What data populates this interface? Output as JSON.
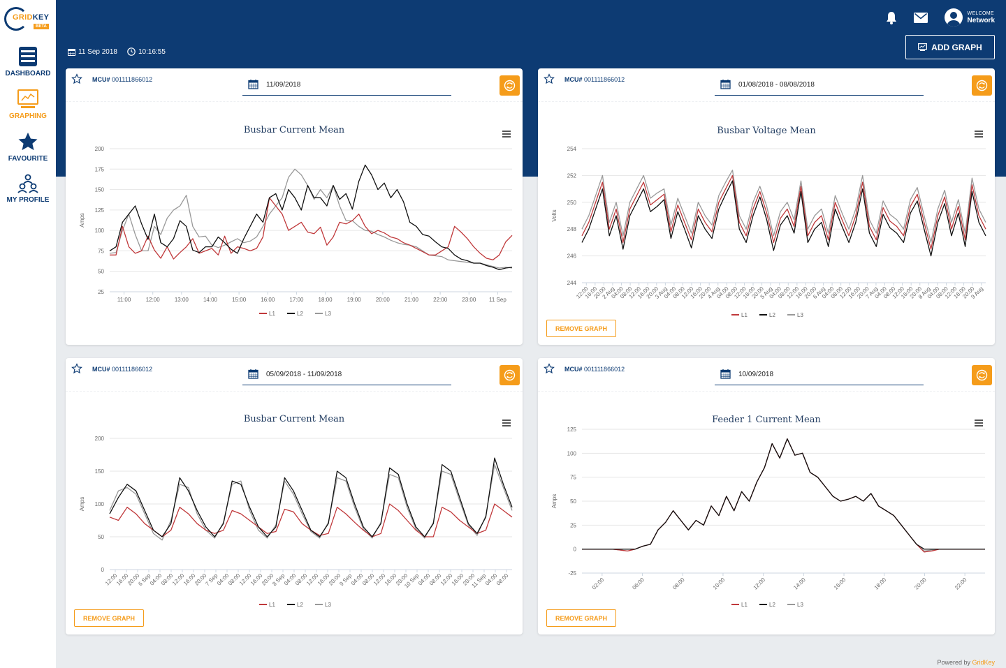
{
  "app": {
    "logo_text_a": "GRID",
    "logo_text_b": "KEY",
    "logo_badge": "BETA",
    "footer_prefix": "Powered by ",
    "footer_brand": "GridKey"
  },
  "sidebar": {
    "items": [
      {
        "label": "DASHBOARD",
        "icon": "dashboard-icon"
      },
      {
        "label": "GRAPHING",
        "icon": "graphing-icon",
        "active": true
      },
      {
        "label": "FAVOURITE",
        "icon": "star-icon"
      },
      {
        "label": "MY PROFILE",
        "icon": "profile-icon"
      }
    ]
  },
  "header": {
    "welcome": "WELCOME",
    "user": "Network",
    "date": "11 Sep 2018",
    "time": "10:16:55",
    "add_graph": "ADD GRAPH"
  },
  "colors": {
    "navy": "#0d3b73",
    "orange": "#f59c1a",
    "L1": "#c0393b",
    "L2": "#111111",
    "L3": "#999999"
  },
  "cards": [
    {
      "mcu_label": "MCU#",
      "mcu_id": "001111866012",
      "date": "11/09/2018",
      "title": "Busbar Current Mean",
      "remove": null,
      "chart_data": {
        "type": "line",
        "title": "Busbar Current Mean",
        "ylabel": "Amps",
        "ylim": [
          25,
          200
        ],
        "yticks": [
          "200",
          "175",
          "150",
          "125",
          "100",
          "75",
          "50",
          "25"
        ],
        "xticks": [
          "11:00",
          "12:00",
          "13:00",
          "14:00",
          "15:00",
          "16:00",
          "17:00",
          "18:00",
          "19:00",
          "20:00",
          "21:00",
          "22:00",
          "23:00",
          "11 Sep"
        ],
        "legend_position": "bottom",
        "series": [
          {
            "name": "L1",
            "values": [
              70,
              70,
              105,
              80,
              72,
              75,
              93,
              76,
              66,
              80,
              65,
              73,
              80,
              90,
              72,
              75,
              78,
              70,
              93,
              72,
              80,
              78,
              75,
              78,
              92,
              140,
              130,
              120,
              100,
              105,
              110,
              98,
              96,
              104,
              82,
              92,
              110,
              108,
              112,
              120,
              105,
              96,
              100,
              97,
              92,
              90,
              85,
              82,
              78,
              74,
              70,
              70,
              75,
              80,
              105,
              98,
              90,
              80,
              72,
              66,
              64,
              70,
              86,
              94
            ]
          },
          {
            "name": "L2",
            "values": [
              75,
              80,
              110,
              120,
              130,
              108,
              89,
              120,
              85,
              80,
              90,
              112,
              105,
              76,
              73,
              80,
              80,
              92,
              85,
              77,
              72,
              90,
              105,
              120,
              110,
              140,
              145,
              125,
              150,
              140,
              125,
              155,
              140,
              140,
              130,
              155,
              138,
              145,
              126,
              160,
              180,
              168,
              150,
              158,
              140,
              150,
              135,
              110,
              105,
              95,
              93,
              86,
              80,
              78,
              70,
              65,
              63,
              60,
              60,
              57,
              55,
              52,
              54,
              55
            ]
          },
          {
            "name": "L3",
            "values": [
              72,
              73,
              100,
              120,
              95,
              75,
              75,
              105,
              95,
              115,
              125,
              130,
              143,
              105,
              92,
              93,
              82,
              79,
              82,
              86,
              90,
              85,
              87,
              92,
              105,
              120,
              130,
              140,
              165,
              175,
              168,
              155,
              138,
              150,
              140,
              155,
              130,
              112,
              112,
              105,
              100,
              99,
              95,
              92,
              88,
              85,
              83,
              82,
              80,
              75,
              70,
              69,
              68,
              64,
              63,
              62,
              61,
              60,
              60,
              58,
              56,
              54,
              55,
              54
            ]
          }
        ]
      }
    },
    {
      "mcu_label": "MCU#",
      "mcu_id": "001111866012",
      "date": "01/08/2018 - 08/08/2018",
      "title": "Busbar Voltage Mean",
      "remove": "REMOVE GRAPH",
      "chart_data": {
        "type": "line",
        "title": "Busbar Voltage Mean",
        "ylabel": "Volts",
        "ylim": [
          244,
          254
        ],
        "yticks": [
          "254",
          "252",
          "250",
          "248",
          "246",
          "244"
        ],
        "xticks": [
          "12:00",
          "16:00",
          "20:00",
          "2 Aug",
          "04:00",
          "08:00",
          "12:00",
          "16:00",
          "20:00",
          "3 Aug",
          "04:00",
          "08:00",
          "12:00",
          "16:00",
          "20:00",
          "4 Aug",
          "04:00",
          "08:00",
          "12:00",
          "16:00",
          "20:00",
          "5 Aug",
          "04:00",
          "08:00",
          "12:00",
          "16:00",
          "20:00",
          "6 Aug",
          "04:00",
          "08:00",
          "12:00",
          "16:00",
          "20:00",
          "7 Aug",
          "04:00",
          "08:00",
          "12:00",
          "16:00",
          "20:00",
          "8 Aug",
          "04:00",
          "08:00",
          "12:00",
          "16:00",
          "20:00",
          "9 Aug"
        ],
        "legend_position": "bottom",
        "series": [
          {
            "name": "L1",
            "values": [
              247.5,
              248.5,
              250,
              251.5,
              248,
              249.5,
              247,
              249.5,
              250.5,
              251.5,
              249.8,
              250.2,
              250.6,
              247.8,
              249.8,
              248.5,
              247.2,
              249.5,
              248.5,
              247.8,
              250,
              251,
              252,
              248.5,
              247.5,
              249.5,
              250.8,
              249.2,
              247,
              248.8,
              249.5,
              248.2,
              251.2,
              247.5,
              248.5,
              249,
              247.2,
              250,
              248.7,
              247.5,
              249,
              251.5,
              248.2,
              247.2,
              249.6,
              248.6,
              248.2,
              247.5,
              249.7,
              250.6,
              248.5,
              246.5,
              249,
              250.4,
              248,
              249.7,
              247.2,
              251.3,
              249,
              248
            ]
          },
          {
            "name": "L2",
            "values": [
              247,
              248,
              249.5,
              251,
              247.5,
              249,
              246.5,
              249,
              250,
              251,
              249.3,
              249.7,
              250.2,
              247.3,
              249.3,
              248,
              246.6,
              249,
              248,
              247.3,
              249.5,
              250.6,
              251.6,
              248,
              247,
              249,
              250.4,
              248.7,
              246.4,
              248.3,
              249,
              247.7,
              250.8,
              247,
              248,
              248.5,
              246.7,
              249.5,
              248.2,
              247,
              248.5,
              251,
              247.7,
              246.7,
              249.1,
              248.1,
              247.7,
              247,
              249.2,
              250.1,
              248,
              246,
              248.5,
              249.9,
              247.5,
              249.2,
              246.7,
              250.8,
              248.5,
              247.5
            ]
          },
          {
            "name": "L3",
            "values": [
              248,
              249,
              250.5,
              252,
              248.5,
              250,
              247.5,
              250,
              251,
              252,
              250.3,
              250.7,
              251,
              248.3,
              250.3,
              249,
              247.7,
              250,
              249,
              248.3,
              250.5,
              251.5,
              252.4,
              249,
              248,
              250,
              251.2,
              249.7,
              247.5,
              249.3,
              250,
              248.7,
              251.6,
              248,
              249,
              249.5,
              247.7,
              250.5,
              249.2,
              248,
              249.5,
              252,
              248.7,
              247.7,
              250.1,
              249.1,
              248.7,
              248,
              250.2,
              251.1,
              249,
              247,
              249.5,
              250.9,
              248.5,
              250.2,
              247.7,
              251.8,
              249.5,
              248.5
            ]
          }
        ]
      }
    },
    {
      "mcu_label": "MCU#",
      "mcu_id": "001111866012",
      "date": "05/09/2018 - 11/09/2018",
      "title": "Busbar Current Mean",
      "remove": "REMOVE GRAPH",
      "chart_data": {
        "type": "line",
        "title": "Busbar Current Mean",
        "ylabel": "Amps",
        "ylim": [
          0,
          200
        ],
        "yticks": [
          "200",
          "150",
          "100",
          "50",
          "0"
        ],
        "xticks": [
          "12:00",
          "16:00",
          "20:00",
          "6 Sep",
          "04:00",
          "08:00",
          "12:00",
          "16:00",
          "20:00",
          "7 Sep",
          "04:00",
          "08:00",
          "12:00",
          "16:00",
          "20:00",
          "8 Sep",
          "04:00",
          "08:00",
          "12:00",
          "16:00",
          "20:00",
          "9 Sep",
          "04:00",
          "08:00",
          "12:00",
          "16:00",
          "20:00",
          "10 Sep",
          "04:00",
          "08:00",
          "12:00",
          "16:00",
          "20:00",
          "11 Sep",
          "04:00",
          "08:00"
        ],
        "legend_position": "bottom",
        "series": [
          {
            "name": "L1",
            "values": [
              80,
              75,
              95,
              85,
              70,
              60,
              50,
              60,
              95,
              85,
              70,
              60,
              55,
              60,
              90,
              85,
              75,
              65,
              55,
              58,
              92,
              88,
              70,
              60,
              52,
              55,
              95,
              85,
              72,
              60,
              50,
              55,
              100,
              90,
              75,
              60,
              50,
              50,
              95,
              88,
              75,
              65,
              55,
              60,
              100,
              90,
              80
            ]
          },
          {
            "name": "L2",
            "values": [
              85,
              110,
              130,
              120,
              90,
              60,
              50,
              70,
              140,
              120,
              90,
              65,
              50,
              70,
              135,
              130,
              95,
              65,
              50,
              65,
              140,
              120,
              90,
              60,
              50,
              70,
              150,
              140,
              100,
              65,
              50,
              70,
              155,
              145,
              100,
              65,
              50,
              70,
              160,
              150,
              110,
              70,
              55,
              80,
              170,
              130,
              95
            ]
          },
          {
            "name": "L3",
            "values": [
              90,
              120,
              125,
              115,
              85,
              55,
              45,
              75,
              130,
              125,
              85,
              60,
              48,
              72,
              130,
              135,
              90,
              60,
              48,
              68,
              135,
              115,
              85,
              58,
              48,
              72,
              140,
              135,
              95,
              62,
              48,
              72,
              145,
              140,
              95,
              62,
              48,
              72,
              150,
              145,
              105,
              68,
              52,
              82,
              160,
              125,
              90
            ]
          }
        ]
      }
    },
    {
      "mcu_label": "MCU#",
      "mcu_id": "001111866012",
      "date": "10/09/2018",
      "title": "Feeder 1 Current Mean",
      "remove": "REMOVE GRAPH",
      "chart_data": {
        "type": "line",
        "title": "Feeder 1 Current Mean",
        "ylabel": "Amps",
        "ylim": [
          -25,
          125
        ],
        "yticks": [
          "125",
          "100",
          "75",
          "50",
          "25",
          "0",
          "-25"
        ],
        "xticks": [
          "02:00",
          "06:00",
          "08:00",
          "10:00",
          "12:00",
          "14:00",
          "16:00",
          "18:00",
          "20:00",
          "22:00"
        ],
        "legend_position": "bottom",
        "series": [
          {
            "name": "L1",
            "values": [
              0,
              0,
              0,
              0,
              0,
              -1,
              -2,
              0,
              3,
              5,
              20,
              28,
              40,
              30,
              20,
              30,
              25,
              45,
              35,
              55,
              40,
              60,
              50,
              70,
              85,
              110,
              95,
              115,
              98,
              100,
              80,
              75,
              65,
              55,
              50,
              52,
              55,
              50,
              58,
              45,
              40,
              35,
              25,
              15,
              5,
              -3,
              -2,
              0,
              0,
              0,
              0,
              0,
              0,
              0
            ]
          },
          {
            "name": "L2",
            "values": [
              0,
              0,
              0,
              0,
              0,
              0,
              0,
              0,
              3,
              5,
              20,
              28,
              40,
              30,
              20,
              30,
              25,
              45,
              35,
              55,
              40,
              60,
              50,
              70,
              85,
              110,
              95,
              115,
              98,
              100,
              80,
              75,
              65,
              55,
              50,
              52,
              55,
              50,
              58,
              45,
              40,
              35,
              25,
              15,
              5,
              0,
              0,
              0,
              0,
              0,
              0,
              0,
              0,
              0
            ]
          },
          {
            "name": "L3",
            "values": [
              0,
              0,
              0,
              0,
              0,
              -1,
              -2,
              0,
              3,
              5,
              20,
              28,
              40,
              30,
              20,
              30,
              25,
              45,
              35,
              55,
              40,
              60,
              50,
              70,
              85,
              110,
              95,
              115,
              98,
              100,
              80,
              75,
              65,
              55,
              50,
              52,
              55,
              50,
              58,
              45,
              40,
              35,
              25,
              15,
              5,
              -2,
              -1,
              0,
              0,
              0,
              0,
              0,
              0,
              0
            ]
          }
        ]
      }
    }
  ]
}
